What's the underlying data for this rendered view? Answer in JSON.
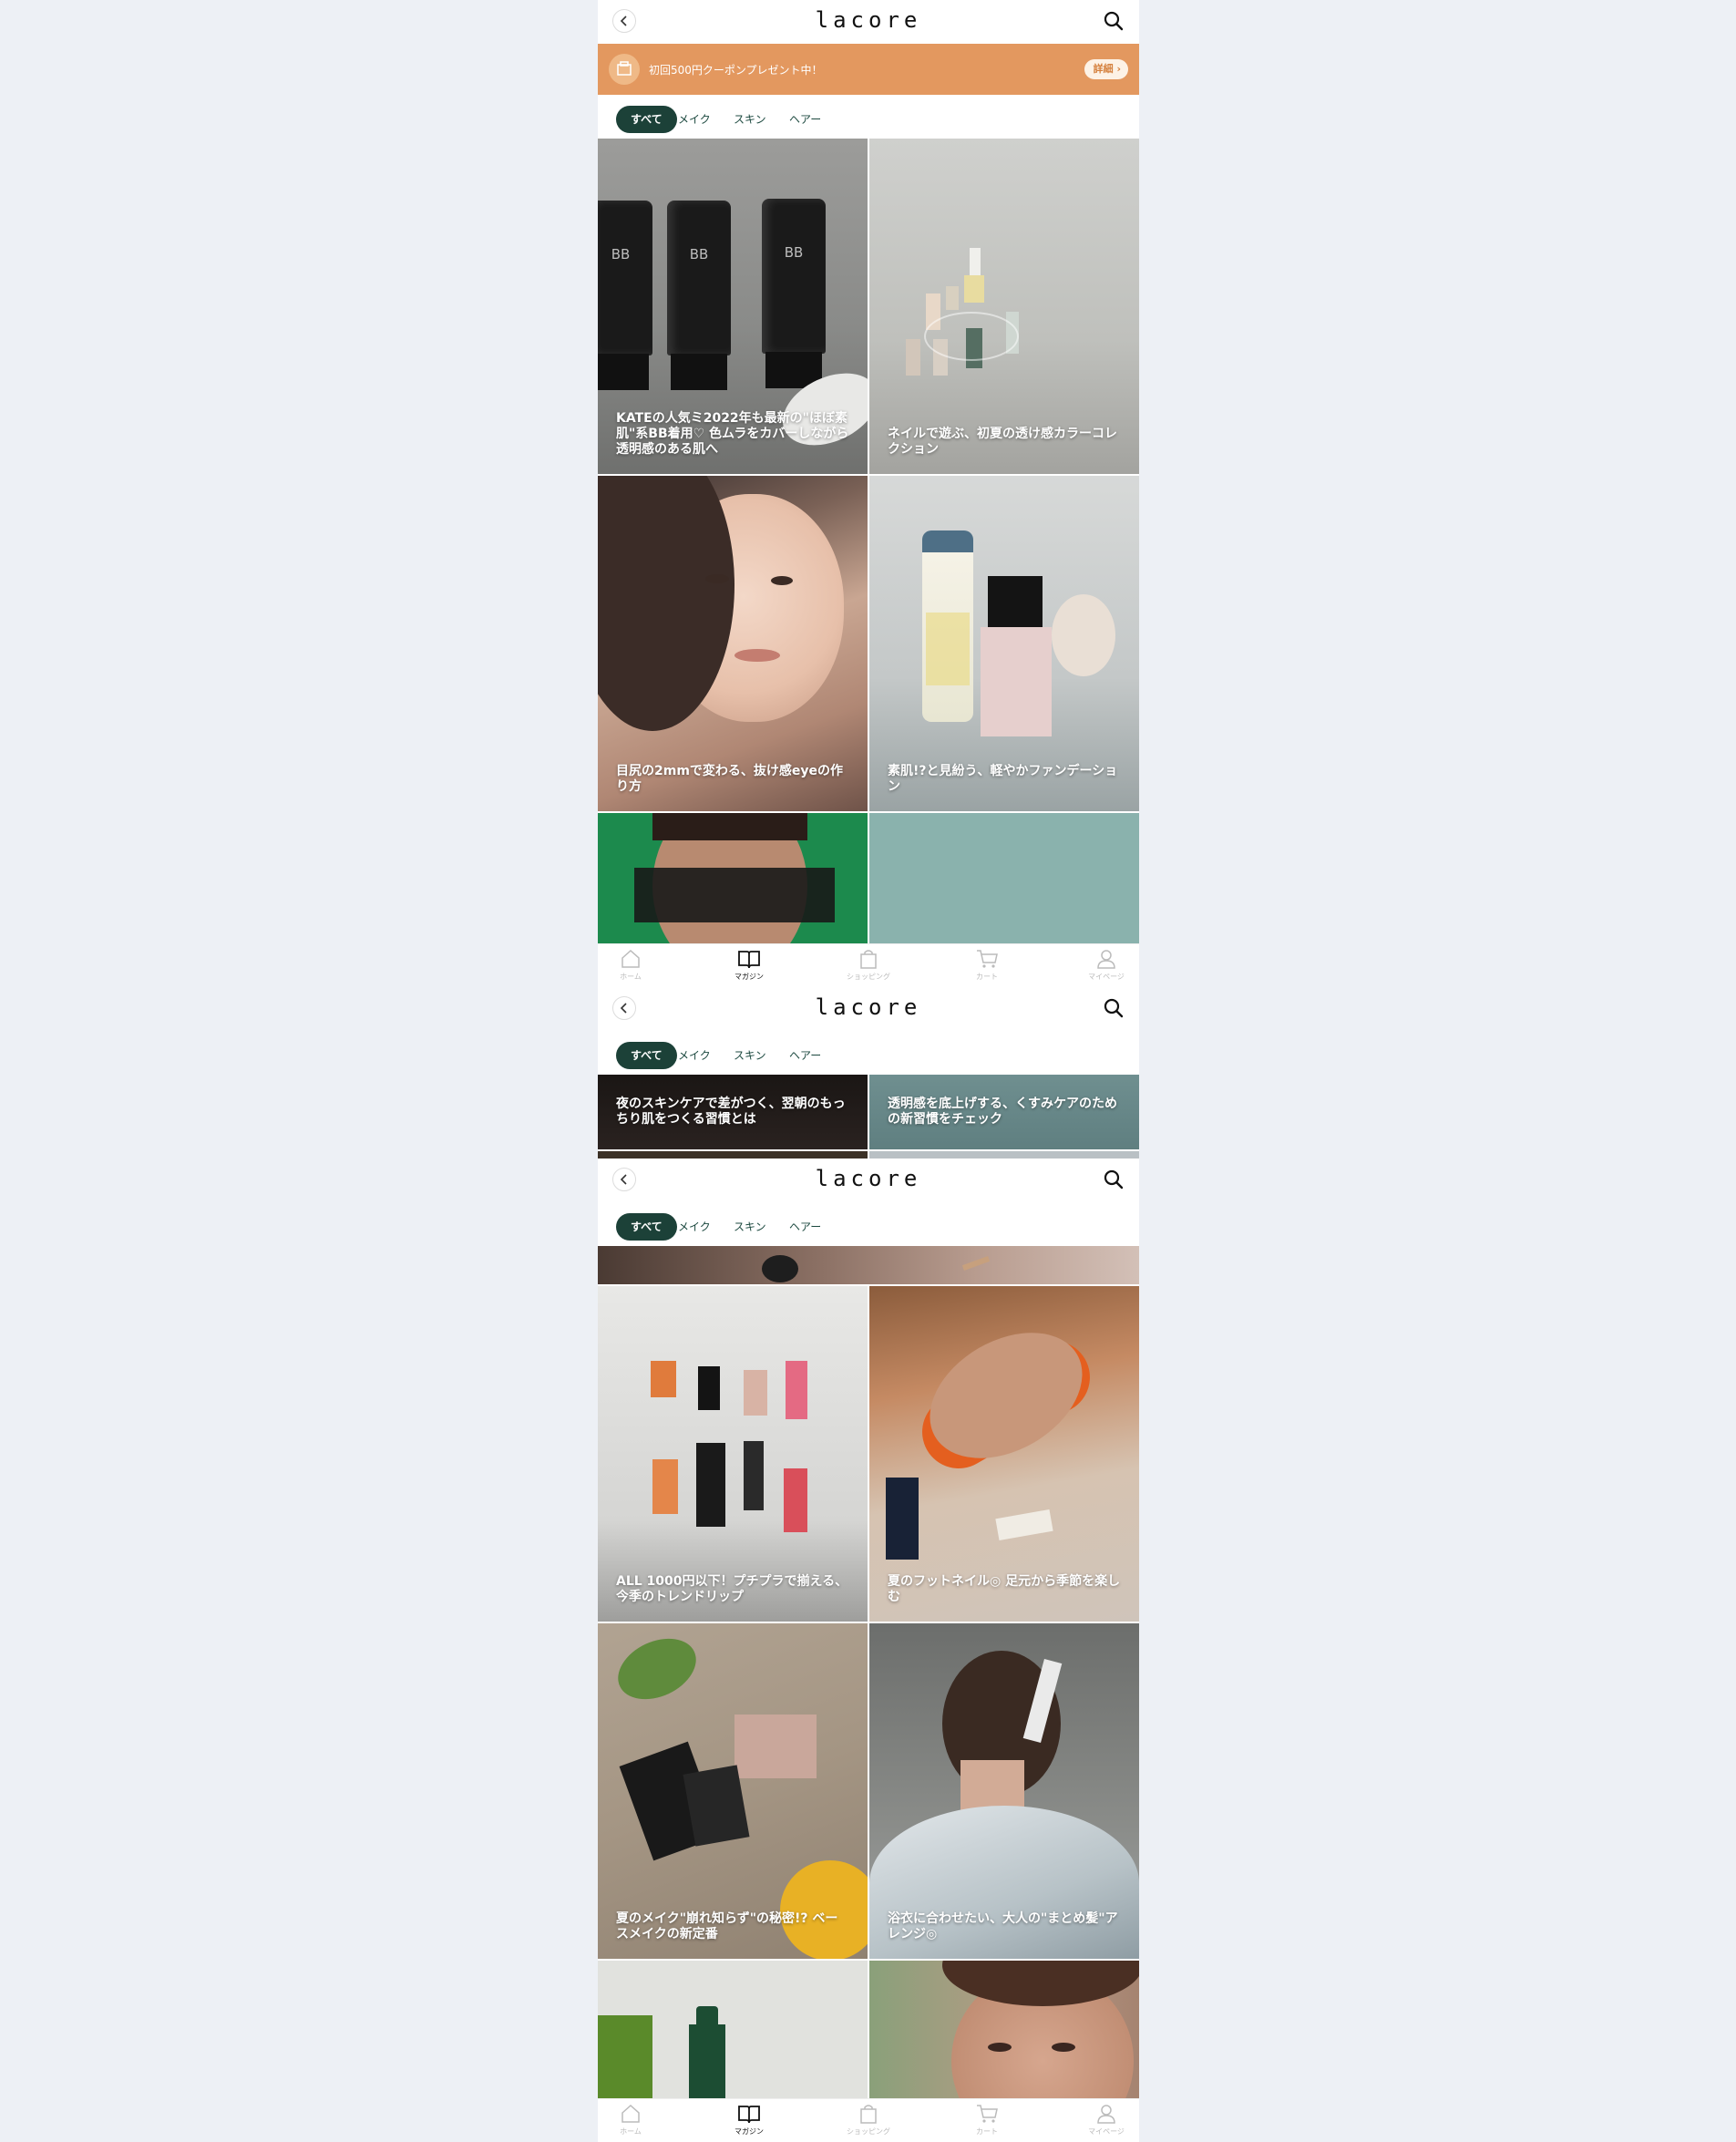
{
  "header": {
    "logo": "lacore"
  },
  "promo": {
    "text": "初回500円クーポンプレゼント中！",
    "button": "詳細"
  },
  "tabs": [
    {
      "label": "すべて"
    },
    {
      "label": "メイク"
    },
    {
      "label": "スキン"
    },
    {
      "label": "ヘアー"
    }
  ],
  "articles_top": [
    {
      "title": "KATEの人気ミ2022年も最新の\"ほぼ素肌\"系BB着用♡ 色ムラをカバーしながら透明感のある肌へ"
    },
    {
      "title": "ネイルで遊ぶ、初夏の透け感カラーコレクション"
    },
    {
      "title": "目尻の2mmで変わる、抜け感eyeの作り方"
    },
    {
      "title": "素肌!?と見紛う、軽やかファンデーション"
    }
  ],
  "articles_mid": [
    {
      "title": "夜のスキンケアで差がつく、翌朝のもっちり肌をつくる習慣とは"
    },
    {
      "title": "透明感を底上げする、くすみケアのための新習慣をチェック"
    }
  ],
  "articles_bottom": [
    {
      "title": "ALL 1000円以下！プチプラで揃える、今季のトレンドリップ"
    },
    {
      "title": "夏のフットネイル◎ 足元から季節を楽しむ"
    },
    {
      "title": "夏のメイク\"崩れ知らず\"の秘密!? ベースメイクの新定番"
    },
    {
      "title": "浴衣に合わせたい、大人の\"まとめ髪\"アレンジ◎"
    }
  ],
  "nav": [
    {
      "label": "ホーム",
      "icon": "home-icon"
    },
    {
      "label": "マガジン",
      "icon": "book-icon"
    },
    {
      "label": "ショッピング",
      "icon": "shopping-bag-icon"
    },
    {
      "label": "カート",
      "icon": "cart-icon"
    },
    {
      "label": "マイページ",
      "icon": "user-icon"
    }
  ],
  "colors": {
    "promo_bg": "#e3985f",
    "tab_active": "#1c4138",
    "page_bg": "#edf0f5"
  }
}
